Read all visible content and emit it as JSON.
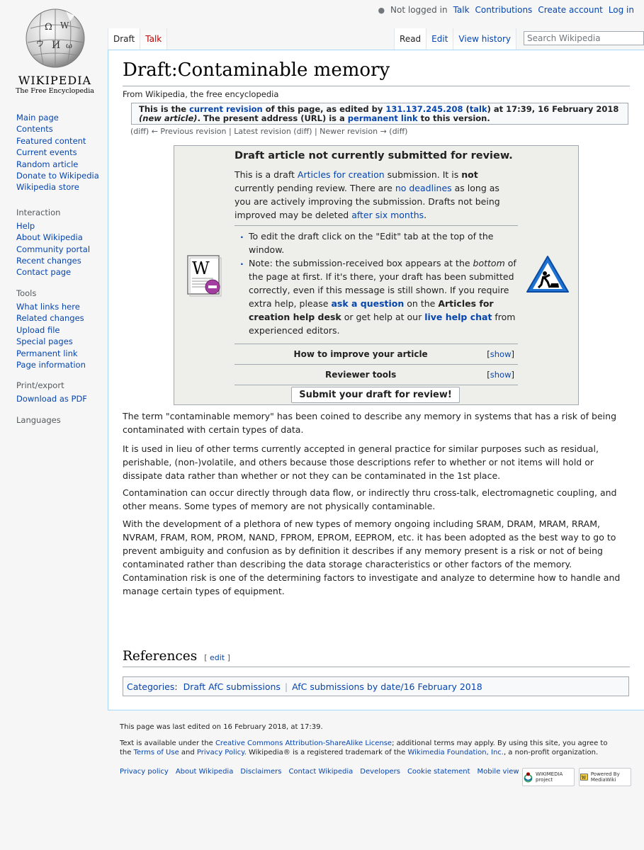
{
  "personal": {
    "not_logged_in": "Not logged in",
    "talk": "Talk",
    "contributions": "Contributions",
    "create_account": "Create account",
    "log_in": "Log in"
  },
  "logo": {
    "wordmark": "WIKIPEDIA",
    "tagline": "The Free Encyclopedia"
  },
  "sidebar": {
    "navigation": [
      "Main page",
      "Contents",
      "Featured content",
      "Current events",
      "Random article",
      "Donate to Wikipedia",
      "Wikipedia store"
    ],
    "interaction_title": "Interaction",
    "interaction": [
      "Help",
      "About Wikipedia",
      "Community portal",
      "Recent changes",
      "Contact page"
    ],
    "tools_title": "Tools",
    "tools": [
      "What links here",
      "Related changes",
      "Upload file",
      "Special pages",
      "Permanent link",
      "Page information"
    ],
    "print_title": "Print/export",
    "print": [
      "Download as PDF"
    ],
    "languages_title": "Languages"
  },
  "tabs": {
    "draft": "Draft",
    "talk": "Talk",
    "read": "Read",
    "edit": "Edit",
    "history": "View history"
  },
  "search": {
    "placeholder": "Search Wikipedia"
  },
  "page": {
    "title": "Draft:Contaminable memory",
    "site_sub": "From Wikipedia, the free encyclopedia",
    "revision": {
      "p1": "This is the ",
      "current_revision": "current revision",
      "p2": " of this page, as edited by ",
      "ip": "131.137.245.208",
      "p3": " (",
      "talk": "talk",
      "p4": ") at 17:39, 16 February 2018 ",
      "new_article": "(new article)",
      "p5": ". The present address (URL) is a ",
      "permanent_link": "permanent link",
      "p6": " to this version."
    },
    "revnav": "(diff) ← Previous revision | Latest revision (diff) | Newer revision → (diff)"
  },
  "afc": {
    "heading": "Draft article not currently submitted for review.",
    "intro1": "This is a draft ",
    "intro_link1": "Articles for creation",
    "intro2": " submission. It is ",
    "intro_not": "not",
    "intro3": " currently pending review. There are ",
    "intro_link2": "no deadlines",
    "intro4": " as long as you are actively improving the submission. Drafts not being improved may be deleted ",
    "intro_link3": "after six months",
    "intro5": ".",
    "bullet1": "To edit the draft click on the \"Edit\" tab at the top of the window.",
    "b2_1": "Note: the submission-received box appears at the ",
    "b2_bottom": "bottom",
    "b2_2": " of the page at first. If it's there, your draft has been submitted correctly, even if this message is still shown. If you require extra help, please ",
    "b2_link1": "ask a question",
    "b2_3": " on the ",
    "b2_bold": "Articles for creation help desk",
    "b2_4": " or get help at our ",
    "b2_link2": "live help chat",
    "b2_5": " from experienced editors.",
    "improve": "How to improve your article",
    "reviewer": "Reviewer tools",
    "show": "show",
    "submit": "Submit your draft for review!"
  },
  "body": {
    "p1": "The term \"contaminable memory\" has been coined to describe any memory in systems that has a risk of being contaminated with certain types of data.",
    "p2": "It is used in lieu of other terms currently accepted in general practice for similar purposes such as residual, perishable, (non-)volatile, and others because those descriptions refer to whether or not items will hold or dissipate data rather than whether or not they can be contaminated in the 1st place.",
    "p3": "Contamination can occur directly through data flow, or indirectly thru cross-talk, electromagnetic coupling, and other means. Some types of memory are not physically contaminable.",
    "p4": "With the development of a plethora of new types of memory ongoing including SRAM, DRAM, MRAM, RRAM, NVRAM, FRAM, ROM, PROM, NAND, FPROM, EPROM, EEPROM, etc. it has been adopted as the best way to go to prevent ambiguity and confusion as by definition it describes if any memory present is a risk or not of being contaminated rather than describing the data storage characteristics or other factors of the memory. Contamination risk is one of the determining factors to investigate and analyze to determine how to handle and manage certain types of equipment."
  },
  "references": {
    "heading": "References",
    "edit": "edit"
  },
  "categories": {
    "label": "Categories",
    "c1": "Draft AfC submissions",
    "c2": "AfC submissions by date/16 February 2018"
  },
  "footer": {
    "last_edited": "This page was last edited on 16 February 2018, at 17:39.",
    "license1": "Text is available under the ",
    "license_link": "Creative Commons Attribution-ShareAlike License",
    "license2": "; additional terms may apply. By using this site, you agree to the ",
    "terms": "Terms of Use",
    "and": " and ",
    "privacy": "Privacy Policy",
    "license3": ". Wikipedia® is a registered trademark of the ",
    "wmf": "Wikimedia Foundation, Inc.",
    "license4": ", a non-profit organization.",
    "links": [
      "Privacy policy",
      "About Wikipedia",
      "Disclaimers",
      "Contact Wikipedia",
      "Developers",
      "Cookie statement",
      "Mobile view"
    ],
    "wikimedia_badge": "WIKIMEDIA project",
    "mediawiki_badge": "Powered By MediaWiki"
  }
}
